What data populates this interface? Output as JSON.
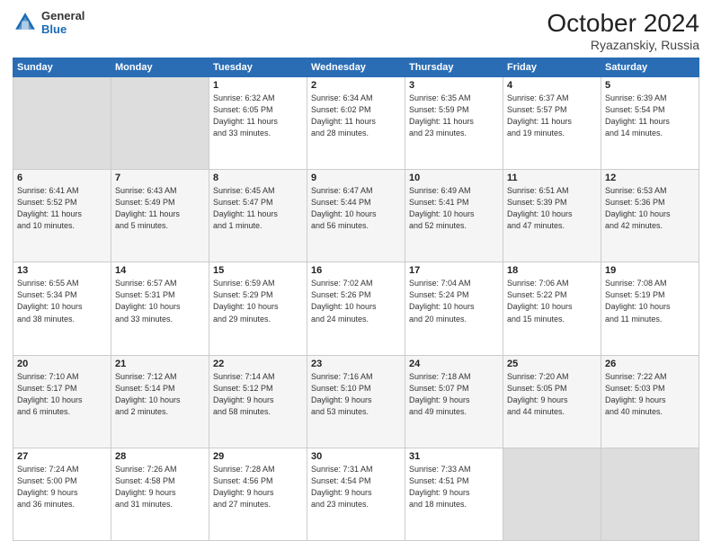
{
  "header": {
    "logo_general": "General",
    "logo_blue": "Blue",
    "month": "October 2024",
    "location": "Ryazanskiy, Russia"
  },
  "weekdays": [
    "Sunday",
    "Monday",
    "Tuesday",
    "Wednesday",
    "Thursday",
    "Friday",
    "Saturday"
  ],
  "rows": [
    [
      {
        "day": "",
        "info": ""
      },
      {
        "day": "",
        "info": ""
      },
      {
        "day": "1",
        "info": "Sunrise: 6:32 AM\nSunset: 6:05 PM\nDaylight: 11 hours\nand 33 minutes."
      },
      {
        "day": "2",
        "info": "Sunrise: 6:34 AM\nSunset: 6:02 PM\nDaylight: 11 hours\nand 28 minutes."
      },
      {
        "day": "3",
        "info": "Sunrise: 6:35 AM\nSunset: 5:59 PM\nDaylight: 11 hours\nand 23 minutes."
      },
      {
        "day": "4",
        "info": "Sunrise: 6:37 AM\nSunset: 5:57 PM\nDaylight: 11 hours\nand 19 minutes."
      },
      {
        "day": "5",
        "info": "Sunrise: 6:39 AM\nSunset: 5:54 PM\nDaylight: 11 hours\nand 14 minutes."
      }
    ],
    [
      {
        "day": "6",
        "info": "Sunrise: 6:41 AM\nSunset: 5:52 PM\nDaylight: 11 hours\nand 10 minutes."
      },
      {
        "day": "7",
        "info": "Sunrise: 6:43 AM\nSunset: 5:49 PM\nDaylight: 11 hours\nand 5 minutes."
      },
      {
        "day": "8",
        "info": "Sunrise: 6:45 AM\nSunset: 5:47 PM\nDaylight: 11 hours\nand 1 minute."
      },
      {
        "day": "9",
        "info": "Sunrise: 6:47 AM\nSunset: 5:44 PM\nDaylight: 10 hours\nand 56 minutes."
      },
      {
        "day": "10",
        "info": "Sunrise: 6:49 AM\nSunset: 5:41 PM\nDaylight: 10 hours\nand 52 minutes."
      },
      {
        "day": "11",
        "info": "Sunrise: 6:51 AM\nSunset: 5:39 PM\nDaylight: 10 hours\nand 47 minutes."
      },
      {
        "day": "12",
        "info": "Sunrise: 6:53 AM\nSunset: 5:36 PM\nDaylight: 10 hours\nand 42 minutes."
      }
    ],
    [
      {
        "day": "13",
        "info": "Sunrise: 6:55 AM\nSunset: 5:34 PM\nDaylight: 10 hours\nand 38 minutes."
      },
      {
        "day": "14",
        "info": "Sunrise: 6:57 AM\nSunset: 5:31 PM\nDaylight: 10 hours\nand 33 minutes."
      },
      {
        "day": "15",
        "info": "Sunrise: 6:59 AM\nSunset: 5:29 PM\nDaylight: 10 hours\nand 29 minutes."
      },
      {
        "day": "16",
        "info": "Sunrise: 7:02 AM\nSunset: 5:26 PM\nDaylight: 10 hours\nand 24 minutes."
      },
      {
        "day": "17",
        "info": "Sunrise: 7:04 AM\nSunset: 5:24 PM\nDaylight: 10 hours\nand 20 minutes."
      },
      {
        "day": "18",
        "info": "Sunrise: 7:06 AM\nSunset: 5:22 PM\nDaylight: 10 hours\nand 15 minutes."
      },
      {
        "day": "19",
        "info": "Sunrise: 7:08 AM\nSunset: 5:19 PM\nDaylight: 10 hours\nand 11 minutes."
      }
    ],
    [
      {
        "day": "20",
        "info": "Sunrise: 7:10 AM\nSunset: 5:17 PM\nDaylight: 10 hours\nand 6 minutes."
      },
      {
        "day": "21",
        "info": "Sunrise: 7:12 AM\nSunset: 5:14 PM\nDaylight: 10 hours\nand 2 minutes."
      },
      {
        "day": "22",
        "info": "Sunrise: 7:14 AM\nSunset: 5:12 PM\nDaylight: 9 hours\nand 58 minutes."
      },
      {
        "day": "23",
        "info": "Sunrise: 7:16 AM\nSunset: 5:10 PM\nDaylight: 9 hours\nand 53 minutes."
      },
      {
        "day": "24",
        "info": "Sunrise: 7:18 AM\nSunset: 5:07 PM\nDaylight: 9 hours\nand 49 minutes."
      },
      {
        "day": "25",
        "info": "Sunrise: 7:20 AM\nSunset: 5:05 PM\nDaylight: 9 hours\nand 44 minutes."
      },
      {
        "day": "26",
        "info": "Sunrise: 7:22 AM\nSunset: 5:03 PM\nDaylight: 9 hours\nand 40 minutes."
      }
    ],
    [
      {
        "day": "27",
        "info": "Sunrise: 7:24 AM\nSunset: 5:00 PM\nDaylight: 9 hours\nand 36 minutes."
      },
      {
        "day": "28",
        "info": "Sunrise: 7:26 AM\nSunset: 4:58 PM\nDaylight: 9 hours\nand 31 minutes."
      },
      {
        "day": "29",
        "info": "Sunrise: 7:28 AM\nSunset: 4:56 PM\nDaylight: 9 hours\nand 27 minutes."
      },
      {
        "day": "30",
        "info": "Sunrise: 7:31 AM\nSunset: 4:54 PM\nDaylight: 9 hours\nand 23 minutes."
      },
      {
        "day": "31",
        "info": "Sunrise: 7:33 AM\nSunset: 4:51 PM\nDaylight: 9 hours\nand 18 minutes."
      },
      {
        "day": "",
        "info": ""
      },
      {
        "day": "",
        "info": ""
      }
    ]
  ]
}
